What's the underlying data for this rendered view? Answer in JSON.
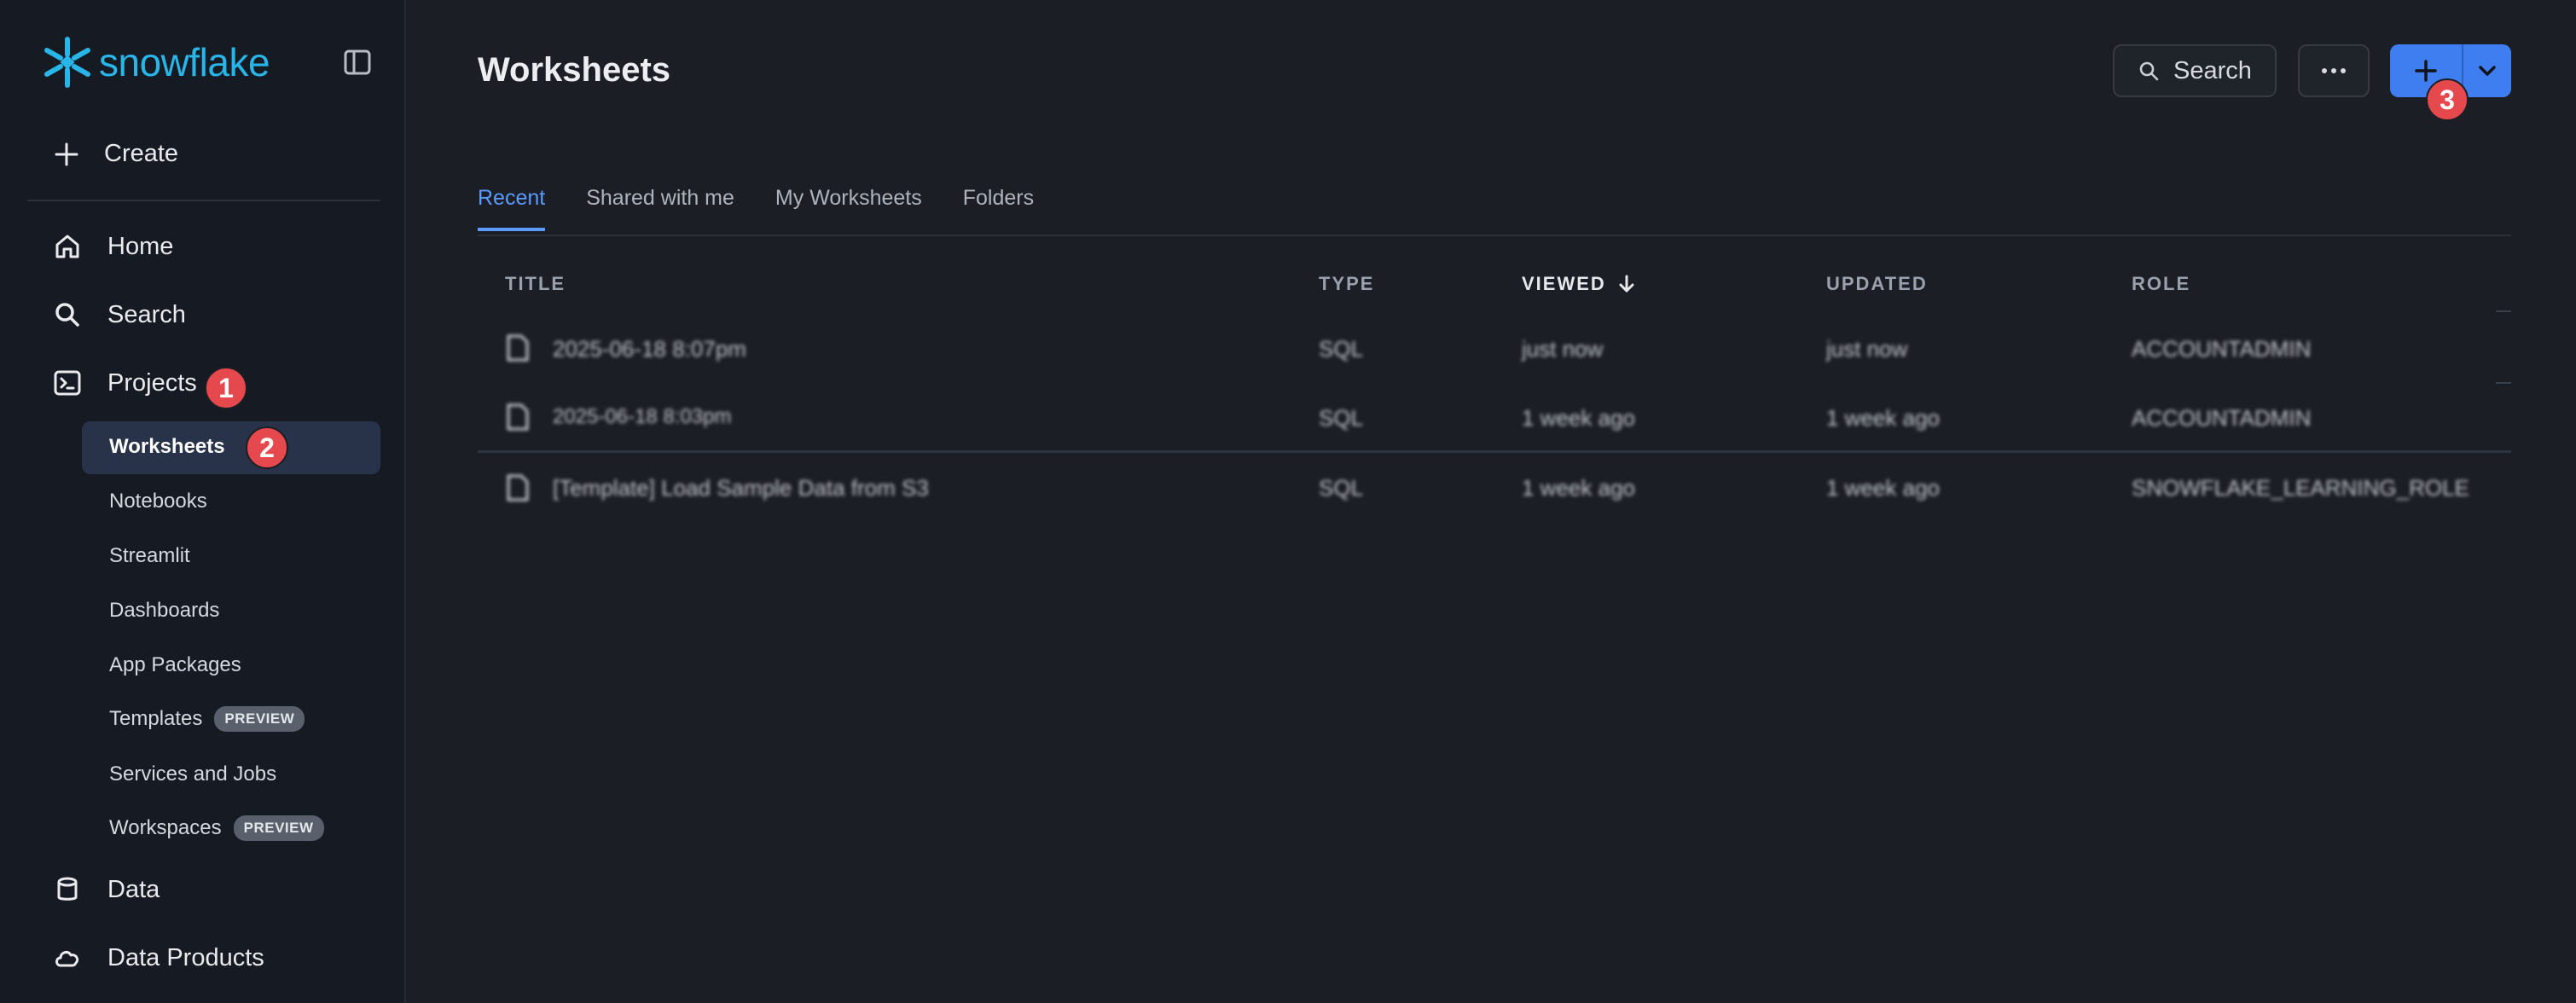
{
  "app": {
    "logo_text": "snowflake"
  },
  "sidebar": {
    "create_label": "Create",
    "nav": [
      {
        "label": "Home",
        "icon": "home-icon"
      },
      {
        "label": "Search",
        "icon": "search-icon"
      },
      {
        "label": "Projects",
        "icon": "terminal-icon"
      },
      {
        "label": "Data",
        "icon": "database-icon"
      },
      {
        "label": "Data Products",
        "icon": "cloud-icon"
      }
    ],
    "projects_sub": [
      {
        "label": "Worksheets"
      },
      {
        "label": "Notebooks"
      },
      {
        "label": "Streamlit"
      },
      {
        "label": "Dashboards"
      },
      {
        "label": "App Packages"
      },
      {
        "label": "Templates",
        "badge": "PREVIEW"
      },
      {
        "label": "Services and Jobs"
      },
      {
        "label": "Workspaces",
        "badge": "PREVIEW"
      }
    ]
  },
  "markers": [
    "1",
    "2",
    "3"
  ],
  "header": {
    "title": "Worksheets",
    "search_label": "Search",
    "more_icon": "ellipsis-icon",
    "add_icon": "plus-icon",
    "dropdown_icon": "chevron-down-icon"
  },
  "tabs": [
    {
      "label": "Recent",
      "active": true
    },
    {
      "label": "Shared with me"
    },
    {
      "label": "My Worksheets"
    },
    {
      "label": "Folders"
    }
  ],
  "table": {
    "columns": [
      "TITLE",
      "TYPE",
      "VIEWED",
      "UPDATED",
      "ROLE"
    ],
    "sorted_column": "VIEWED",
    "sort_direction": "descending",
    "rows": [
      {
        "title": "2025-06-18 8:07pm",
        "type": "SQL",
        "viewed": "just now",
        "updated": "just now",
        "role": "ACCOUNTADMIN"
      },
      {
        "title": "2025-06-18 8:03pm",
        "type": "SQL",
        "viewed": "1 week ago",
        "updated": "1 week ago",
        "role": "ACCOUNTADMIN"
      },
      {
        "title": "[Template] Load Sample Data from S3",
        "type": "SQL",
        "viewed": "1 week ago",
        "updated": "1 week ago",
        "role": "SNOWFLAKE_LEARNING_ROLE"
      }
    ]
  },
  "colors": {
    "accent": "#3f7ef0",
    "brand": "#29b5e8",
    "marker": "#e5484d"
  }
}
